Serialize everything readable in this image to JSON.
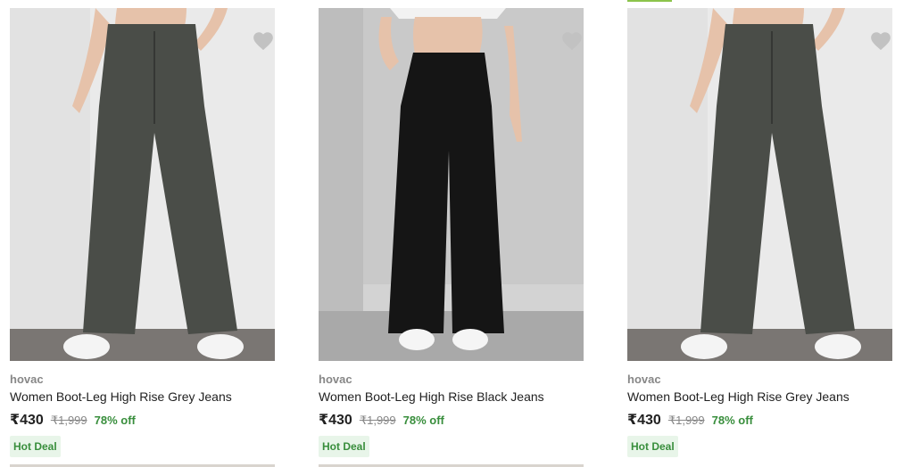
{
  "products": [
    {
      "brand": "hovac",
      "title": "Women Boot-Leg High Rise Grey Jeans",
      "price": "₹430",
      "mrp": "₹1,999",
      "discount": "78% off",
      "badge": "Hot Deal",
      "wishlist_icon": "heart-icon",
      "jeans_color": "#4a4d48"
    },
    {
      "brand": "hovac",
      "title": "Women Boot-Leg High Rise Black Jeans",
      "price": "₹430",
      "mrp": "₹1,999",
      "discount": "78% off",
      "badge": "Hot Deal",
      "wishlist_icon": "heart-icon",
      "jeans_color": "#151515"
    },
    {
      "brand": "hovac",
      "title": "Women Boot-Leg High Rise Grey Jeans",
      "price": "₹430",
      "mrp": "₹1,999",
      "discount": "78% off",
      "badge": "Hot Deal",
      "wishlist_icon": "heart-icon",
      "jeans_color": "#4a4d48"
    }
  ],
  "colors": {
    "discount_green": "#388e3c",
    "badge_bg": "#e8f5e9",
    "muted_text": "#878787",
    "heart": "#c2c2c2"
  }
}
